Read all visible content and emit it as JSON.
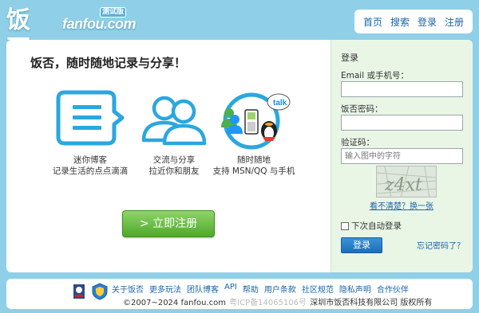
{
  "logo": {
    "cn": "饭否",
    "en": "fanfou.com",
    "badge": "测试版"
  },
  "nav": {
    "items": [
      "首页",
      "搜索",
      "登录",
      "注册"
    ]
  },
  "main": {
    "headline": "饭否，随时随地记录与分享！",
    "features": [
      {
        "line1": "迷你博客",
        "line2": "记录生活的点点滴滴"
      },
      {
        "line1": "交流与分享",
        "line2": "拉近你和朋友"
      },
      {
        "line1": "随时随地",
        "line2": "支持 MSN/QQ 与手机"
      }
    ],
    "phone_bubble": "talk",
    "register_label": "> 立即注册"
  },
  "login": {
    "title": "登录",
    "email_label": "Email 或手机号：",
    "email_value": "",
    "password_label": "饭否密码：",
    "password_value": "",
    "captcha_label": "验证码：",
    "captcha_placeholder": "输入图中的字符",
    "captcha_text": "z4xt",
    "captcha_link": "看不清楚？换一张",
    "auto_login_label": "下次自动登录",
    "auto_login_checked": false,
    "submit_label": "登录",
    "forgot_label": "忘记密码了？"
  },
  "footer": {
    "links": [
      "关于饭否",
      "更多玩法",
      "团队博客",
      "API",
      "帮助",
      "用户条款",
      "社区规范",
      "隐私声明",
      "合作伙伴"
    ],
    "copyright": "©2007~2024 fanfou.com",
    "icp": "粤ICP备14065106号",
    "company": "深圳市饭否科技有限公司 版权所有"
  },
  "colors": {
    "background": "#8fd0e8",
    "link": "#1b64a8",
    "icon_blue": "#2aa7e0",
    "register_green": "#4ea82a",
    "login_panel": "#e9f6e6"
  }
}
